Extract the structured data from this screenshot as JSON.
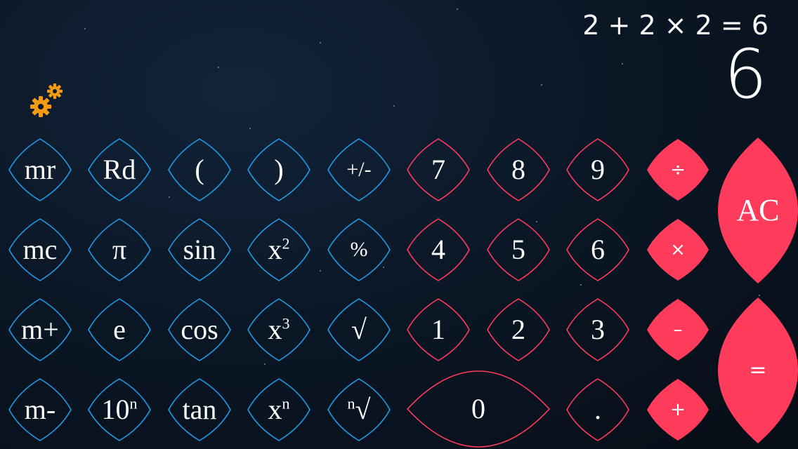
{
  "display": {
    "expression": "2 + 2 × 2 = 6",
    "result": "6"
  },
  "settings_icon": "gears-icon",
  "colors": {
    "blue": "#1e9be8",
    "red": "#ff3b5c",
    "gear": "#f39c12",
    "text": "#ffffff"
  },
  "keys": {
    "mr": "mr",
    "rd": "Rd",
    "lparen": "(",
    "rparen": ")",
    "plusminus": "+/-",
    "mc": "mc",
    "pi": "π",
    "sin": "sin",
    "x2_base": "x",
    "x2_exp": "2",
    "percent": "%",
    "mplus": "m+",
    "e": "e",
    "cos": "cos",
    "x3_base": "x",
    "x3_exp": "3",
    "sqrt": "√",
    "mminus": "m-",
    "tenn_base": "10",
    "tenn_exp": "n",
    "tan": "tan",
    "xn_base": "x",
    "xn_exp": "n",
    "nroot_exp": "n",
    "nroot_base": "√",
    "d7": "7",
    "d8": "8",
    "d9": "9",
    "d4": "4",
    "d5": "5",
    "d6": "6",
    "d1": "1",
    "d2": "2",
    "d3": "3",
    "d0": "0",
    "dot": ".",
    "divide": "÷",
    "multiply": "×",
    "minus": "–",
    "plus": "+",
    "ac": "AC",
    "equals": "="
  }
}
